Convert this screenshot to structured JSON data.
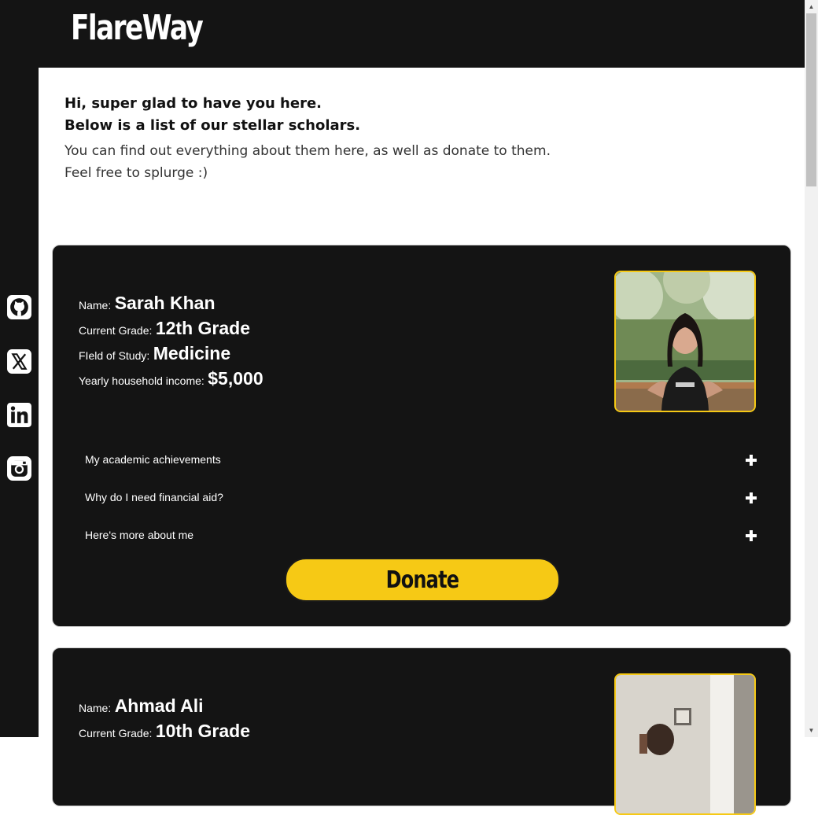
{
  "header": {
    "logo": "FlareWay"
  },
  "sidebar": {
    "icons": [
      "github-icon",
      "x-icon",
      "linkedin-icon",
      "instagram-icon"
    ]
  },
  "intro": {
    "heading_line1": "Hi, super glad to have you here.",
    "heading_line2": "Below is a list of our stellar scholars.",
    "text_line1": "You can find out everything about them here, as well as donate to them.",
    "text_line2": "Feel free to splurge :)"
  },
  "labels": {
    "name": "Name:",
    "grade": "Current Grade:",
    "field": "FIeld of Study:",
    "income": "Yearly household income:"
  },
  "scholars": [
    {
      "name": "Sarah Khan",
      "grade": "12th Grade",
      "field": "Medicine",
      "income": "$5,000",
      "accordion": [
        "My academic achievements",
        "Why do I need financial aid?",
        "Here's more about me"
      ],
      "donate_label": "Donate"
    },
    {
      "name": "Ahmad Ali",
      "grade": "10th Grade"
    }
  ],
  "colors": {
    "accent": "#f6c915",
    "dark": "#141414",
    "background": "#ffffff"
  }
}
